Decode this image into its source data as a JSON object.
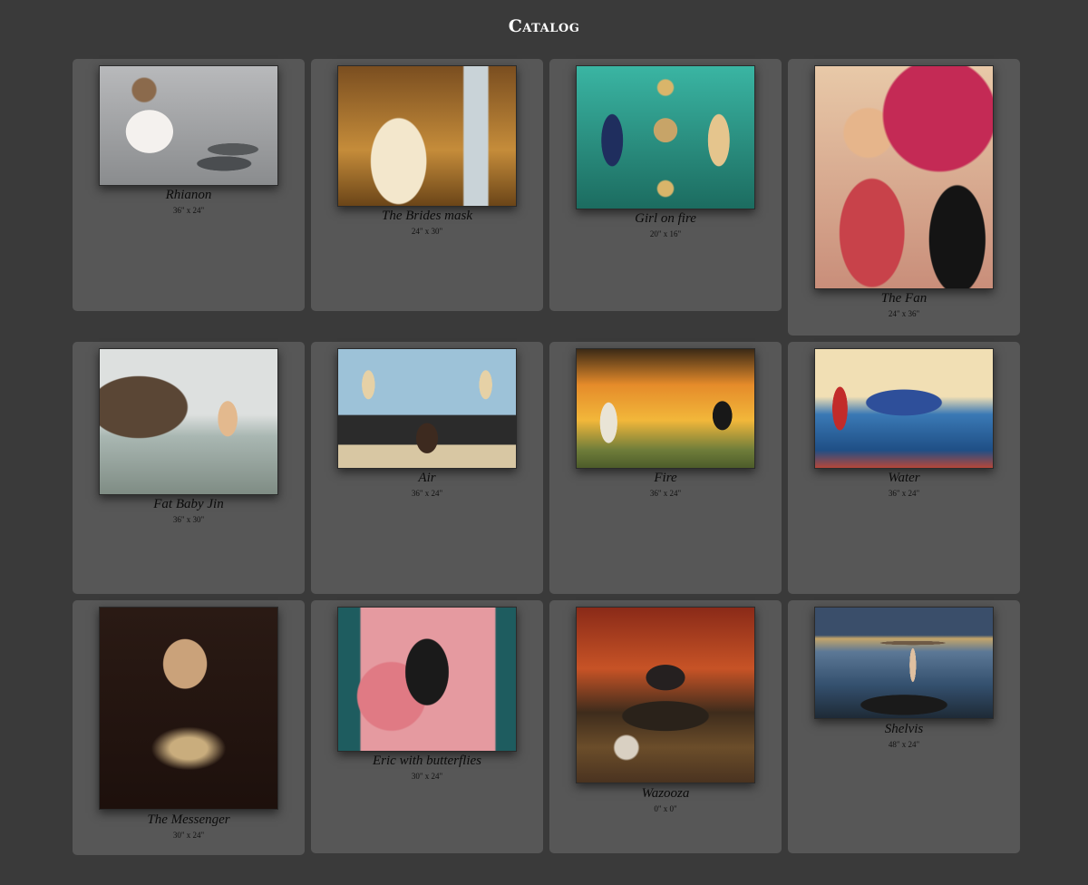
{
  "page": {
    "title": "Catalog"
  },
  "catalog": [
    {
      "title": "Rhianon",
      "size": "36\" x 24\""
    },
    {
      "title": "The Brides mask",
      "size": "24\" x 30\""
    },
    {
      "title": "Girl on fire",
      "size": "20\" x 16\""
    },
    {
      "title": "The Fan",
      "size": "24\" x 36\""
    },
    {
      "title": "Fat Baby Jin",
      "size": "36\" x 30\""
    },
    {
      "title": "Air",
      "size": "36\" x 24\""
    },
    {
      "title": "Fire",
      "size": "36\" x 24\""
    },
    {
      "title": "Water",
      "size": "36\" x 24\""
    },
    {
      "title": "The Messenger",
      "size": "30\" x 24\""
    },
    {
      "title": "Eric with butterflies",
      "size": "30\" x 24\""
    },
    {
      "title": "Wazooza",
      "size": "0\" x 0\""
    },
    {
      "title": "Shelvis",
      "size": "48\" x 24\""
    }
  ],
  "colors": {
    "background": "#3a3a3a",
    "card": "#575757",
    "title": "#ffffff"
  }
}
